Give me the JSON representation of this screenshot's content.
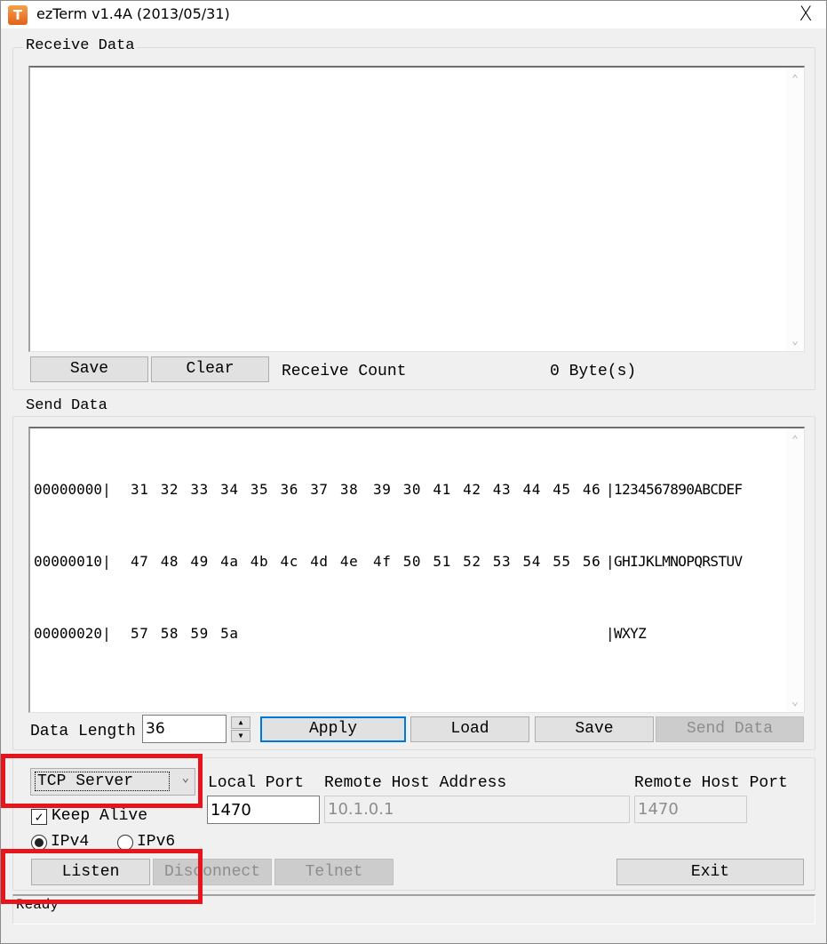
{
  "window": {
    "title": "ezTerm v1.4A (2013/05/31)",
    "app_icon_glyph": "T",
    "close_glyph": "X"
  },
  "receive": {
    "group_label": "Receive Data",
    "content": "",
    "save_label": "Save",
    "clear_label": "Clear",
    "count_label": "Receive Count",
    "count_value": "0 Byte(s)"
  },
  "send": {
    "group_label": "Send Data",
    "rows": [
      {
        "offset": "00000000|",
        "hex1": "31 32 33 34 35 36 37 38",
        "hex2": "39 30 41 42 43 44 45 46",
        "ascii": "|1234567890ABCDEF"
      },
      {
        "offset": "00000010|",
        "hex1": "47 48 49 4a 4b 4c 4d 4e",
        "hex2": "4f 50 51 52 53 54 55 56",
        "ascii": "|GHIJKLMNOPQRSTUV"
      },
      {
        "offset": "00000020|",
        "hex1": "57 58 59 5a",
        "hex2": "",
        "ascii": "|WXYZ"
      }
    ],
    "data_length_label": "Data Length",
    "data_length_value": "36",
    "apply_label": "Apply",
    "load_label": "Load",
    "save_label": "Save",
    "send_label": "Send Data"
  },
  "connection": {
    "mode_selected": "TCP Server",
    "local_port_label": "Local Port",
    "local_port_value": "1470",
    "remote_host_label": "Remote Host Address",
    "remote_host_value": "10.1.0.1",
    "remote_port_label": "Remote Host Port",
    "remote_port_value": "1470",
    "keep_alive_label": "Keep Alive",
    "keep_alive_checked": true,
    "ipv4_label": "IPv4",
    "ipv6_label": "IPv6",
    "ip_selected": "IPv4",
    "listen_label": "Listen",
    "disconnect_label": "Disconnect",
    "telnet_label": "Telnet",
    "exit_label": "Exit"
  },
  "status": {
    "text": "Ready"
  },
  "colors": {
    "highlight": "#e8141c",
    "focus": "#0078d7"
  }
}
